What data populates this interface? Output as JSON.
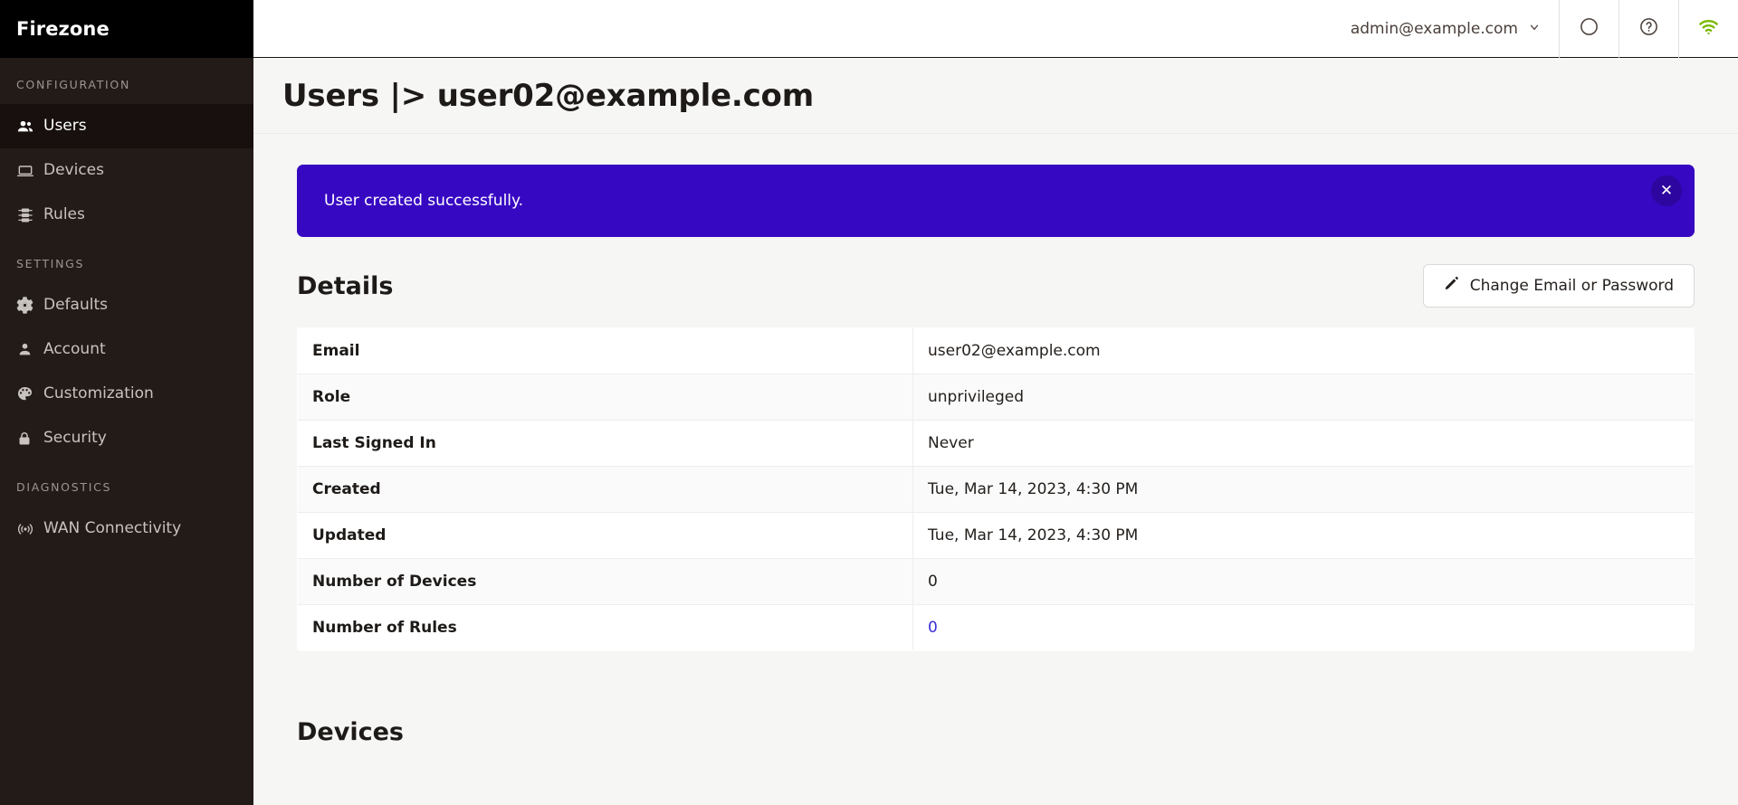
{
  "sidebar": {
    "brand": "Firezone",
    "sections": [
      {
        "title": "CONFIGURATION",
        "items": [
          {
            "label": "Users",
            "icon": "users-icon",
            "active": true
          },
          {
            "label": "Devices",
            "icon": "laptop-icon",
            "active": false
          },
          {
            "label": "Rules",
            "icon": "rules-icon",
            "active": false
          }
        ]
      },
      {
        "title": "SETTINGS",
        "items": [
          {
            "label": "Defaults",
            "icon": "gear-icon",
            "active": false
          },
          {
            "label": "Account",
            "icon": "person-icon",
            "active": false
          },
          {
            "label": "Customization",
            "icon": "palette-icon",
            "active": false
          },
          {
            "label": "Security",
            "icon": "lock-icon",
            "active": false
          }
        ]
      },
      {
        "title": "DIAGNOSTICS",
        "items": [
          {
            "label": "WAN Connectivity",
            "icon": "broadcast-icon",
            "active": false
          }
        ]
      }
    ]
  },
  "topbar": {
    "account_email": "admin@example.com",
    "chevron": "chevron-down-icon",
    "buttons": [
      {
        "name": "circle-icon",
        "title": ""
      },
      {
        "name": "help-circle-icon",
        "title": ""
      },
      {
        "name": "wifi-icon",
        "title": ""
      }
    ]
  },
  "page": {
    "title": "Users |> user02@example.com"
  },
  "alert": {
    "message": "User created successfully.",
    "close_label": "✕",
    "background": "#3708c2",
    "text_color": "#ffffff"
  },
  "details": {
    "heading": "Details",
    "action_button": {
      "label": "Change Email or Password",
      "icon": "pencil-icon"
    },
    "rows": [
      {
        "key": "Email",
        "value": "user02@example.com",
        "is_link": false
      },
      {
        "key": "Role",
        "value": "unprivileged",
        "is_link": false
      },
      {
        "key": "Last Signed In",
        "value": "Never",
        "is_link": false
      },
      {
        "key": "Created",
        "value": "Tue, Mar 14, 2023, 4:30 PM",
        "is_link": false
      },
      {
        "key": "Updated",
        "value": "Tue, Mar 14, 2023, 4:30 PM",
        "is_link": false
      },
      {
        "key": "Number of Devices",
        "value": "0",
        "is_link": false
      },
      {
        "key": "Number of Rules",
        "value": "0",
        "is_link": true
      }
    ]
  },
  "devices": {
    "heading": "Devices"
  },
  "colors": {
    "sidebar_bg": "#231b18",
    "sidebar_active_bg": "#17100e",
    "brand_bg": "#000000",
    "accent_purple": "#3708c2",
    "link": "#3b2fd6",
    "wifi_green": "#7ab800",
    "page_bg": "#f6f6f5"
  }
}
